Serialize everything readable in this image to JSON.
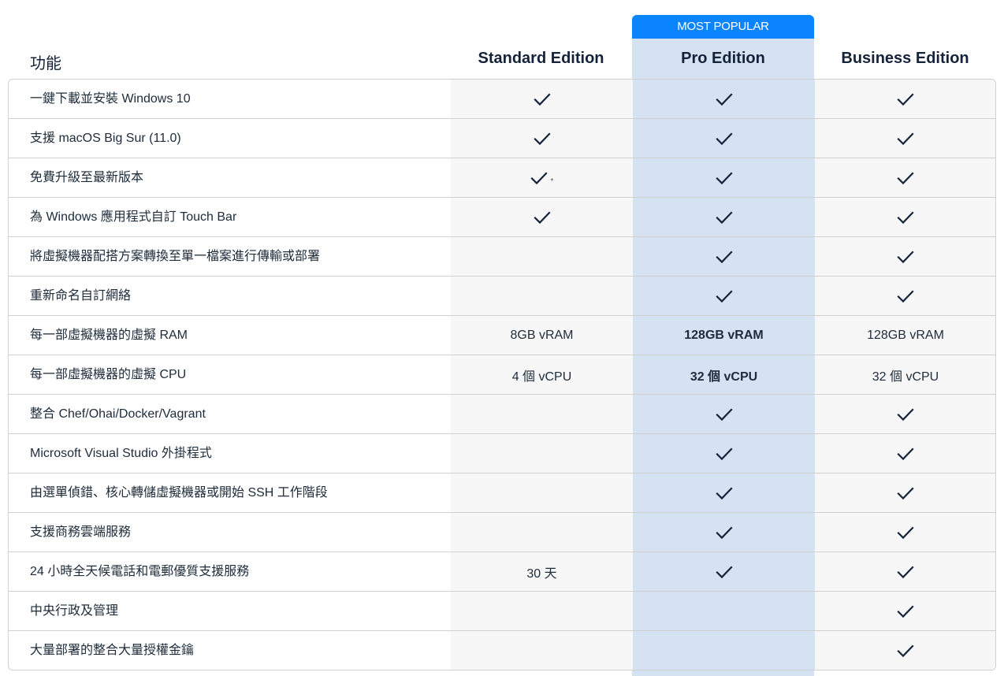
{
  "badge": {
    "label": "MOST POPULAR",
    "color": "#0a84ff"
  },
  "header": {
    "feature_label": "功能",
    "plans": [
      {
        "key": "std",
        "name": "Standard Edition"
      },
      {
        "key": "pro",
        "name": "Pro Edition",
        "highlighted": true
      },
      {
        "key": "biz",
        "name": "Business Edition"
      }
    ]
  },
  "colors": {
    "pro_highlight": "#d4e2f2",
    "alt_column": "#f7f7f7",
    "text": "#1d2b3a"
  },
  "rows": [
    {
      "feature": "一鍵下載並安裝 Windows 10",
      "std": {
        "type": "check"
      },
      "pro": {
        "type": "check"
      },
      "biz": {
        "type": "check"
      }
    },
    {
      "feature": "支援 macOS Big Sur (11.0)",
      "std": {
        "type": "check"
      },
      "pro": {
        "type": "check"
      },
      "biz": {
        "type": "check"
      }
    },
    {
      "feature": "免費升級至最新版本",
      "std": {
        "type": "check",
        "note": "*"
      },
      "pro": {
        "type": "check"
      },
      "biz": {
        "type": "check"
      }
    },
    {
      "feature": "為 Windows 應用程式自訂 Touch Bar",
      "std": {
        "type": "check"
      },
      "pro": {
        "type": "check"
      },
      "biz": {
        "type": "check"
      }
    },
    {
      "feature": "將虛擬機器配搭方案轉換至單一檔案進行傳輸或部署",
      "std": {
        "type": "none"
      },
      "pro": {
        "type": "check"
      },
      "biz": {
        "type": "check"
      }
    },
    {
      "feature": "重新命名自訂網絡",
      "std": {
        "type": "none"
      },
      "pro": {
        "type": "check"
      },
      "biz": {
        "type": "check"
      }
    },
    {
      "feature": "每一部虛擬機器的虛擬 RAM",
      "std": {
        "type": "text",
        "value": "8GB vRAM"
      },
      "pro": {
        "type": "text",
        "value": "128GB vRAM",
        "bold": true
      },
      "biz": {
        "type": "text",
        "value": "128GB vRAM"
      }
    },
    {
      "feature": "每一部虛擬機器的虛擬 CPU",
      "std": {
        "type": "text",
        "value": "4 個 vCPU"
      },
      "pro": {
        "type": "text",
        "value": "32 個 vCPU",
        "bold": true
      },
      "biz": {
        "type": "text",
        "value": "32 個 vCPU"
      }
    },
    {
      "feature": "整合 Chef/Ohai/Docker/Vagrant",
      "std": {
        "type": "none"
      },
      "pro": {
        "type": "check"
      },
      "biz": {
        "type": "check"
      }
    },
    {
      "feature": "Microsoft Visual Studio 外掛程式",
      "std": {
        "type": "none"
      },
      "pro": {
        "type": "check"
      },
      "biz": {
        "type": "check"
      }
    },
    {
      "feature": "由選單偵錯、核心轉儲虛擬機器或開始 SSH 工作階段",
      "std": {
        "type": "none"
      },
      "pro": {
        "type": "check"
      },
      "biz": {
        "type": "check"
      }
    },
    {
      "feature": "支援商務雲端服務",
      "std": {
        "type": "none"
      },
      "pro": {
        "type": "check"
      },
      "biz": {
        "type": "check"
      }
    },
    {
      "feature": "24 小時全天候電話和電郵優質支援服務",
      "std": {
        "type": "text",
        "value": "30 天"
      },
      "pro": {
        "type": "check"
      },
      "biz": {
        "type": "check"
      }
    },
    {
      "feature": "中央行政及管理",
      "std": {
        "type": "none"
      },
      "pro": {
        "type": "none"
      },
      "biz": {
        "type": "check"
      }
    },
    {
      "feature": "大量部署的整合大量授權金鑰",
      "std": {
        "type": "none"
      },
      "pro": {
        "type": "none"
      },
      "biz": {
        "type": "check"
      }
    }
  ]
}
